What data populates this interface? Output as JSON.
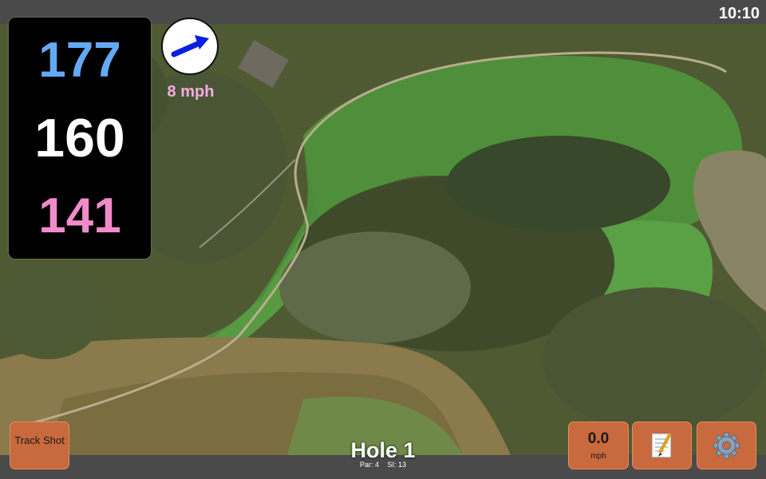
{
  "status": {
    "time": "10:10"
  },
  "distances": {
    "back": "177",
    "middle": "160",
    "front": "141"
  },
  "wind": {
    "speed_label": "8 mph",
    "direction_icon": "wind-arrow-icon"
  },
  "hole": {
    "title": "Hole 1",
    "par": "Par: 4",
    "stroke_index": "SI: 13"
  },
  "buttons": {
    "track_shot": "Track Shot",
    "speed_value": "0.0",
    "speed_unit": "mph",
    "notes_icon": "notepad-icon",
    "settings_icon": "gear-icon"
  },
  "colors": {
    "back_distance": "#64a9f3",
    "middle_distance": "#ffffff",
    "front_distance": "#f08cc9",
    "wind_label": "#f3aee0",
    "button_bg": "#c8693e",
    "bar_bg": "#4a4a4a"
  }
}
